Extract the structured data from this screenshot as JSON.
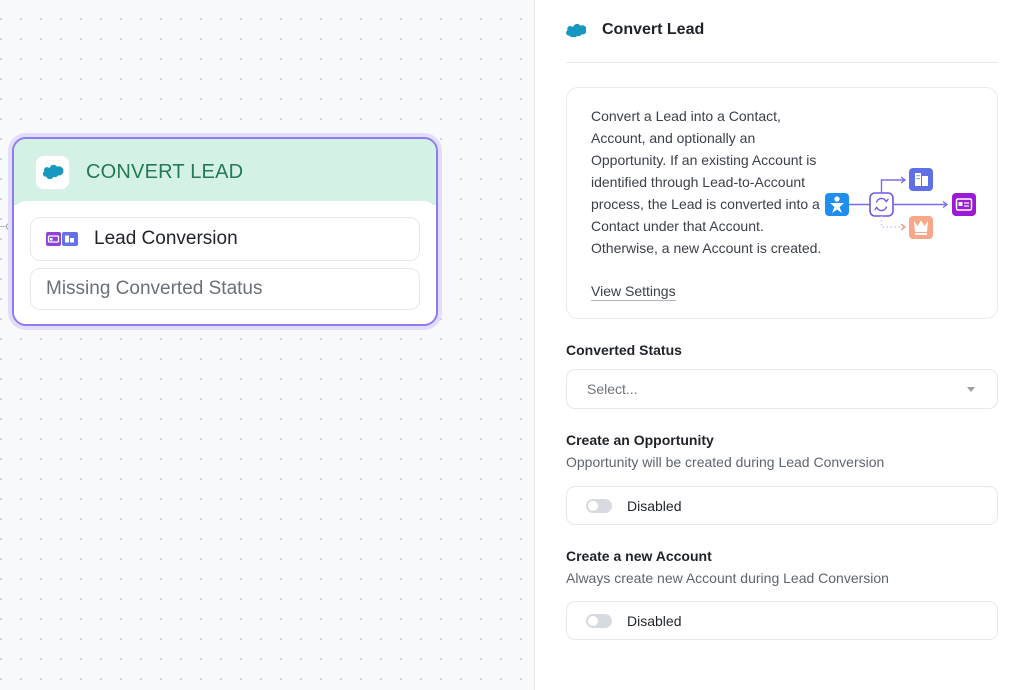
{
  "canvas": {
    "node": {
      "title": "CONVERT LEAD",
      "action_label": "Lead Conversion",
      "warning_label": "Missing Converted Status",
      "header_color": "#d4f1e5",
      "border_color": "#8b7cf1"
    }
  },
  "panel": {
    "title": "Convert Lead",
    "description": "Convert a Lead into a Contact, Account, and optionally an Opportunity. If an existing Account is identified through Lead-to-Account process, the Lead is converted into a Contact under that Account. Otherwise, a new Account is created.",
    "view_settings": "View Settings",
    "converted_status": {
      "label": "Converted Status",
      "placeholder": "Select..."
    },
    "create_opportunity": {
      "label": "Create an Opportunity",
      "description": "Opportunity will be created during Lead Conversion",
      "toggle_label": "Disabled",
      "enabled": false
    },
    "create_account": {
      "label": "Create a new Account",
      "description": "Always create new Account during Lead Conversion",
      "toggle_label": "Disabled",
      "enabled": false
    }
  },
  "colors": {
    "salesforce_blue": "#1798c1",
    "accent_purple": "#8b7cf1",
    "node_title_green": "#237a55"
  }
}
